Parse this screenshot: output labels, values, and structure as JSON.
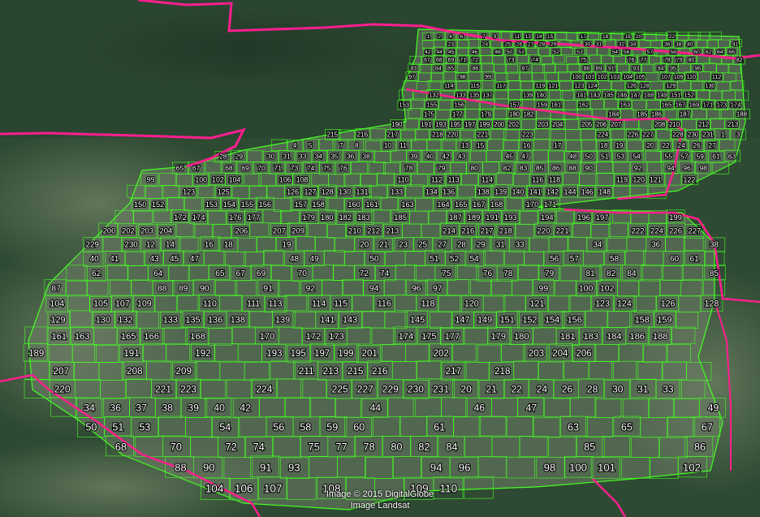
{
  "map": {
    "attribution_lines": [
      "Image © 2015 DigitalGlobe",
      "Image Landsat"
    ],
    "colors": {
      "terrain_base": "#2f4a33",
      "forest_dark": "#243d2a",
      "field_light": "#7a8f6e",
      "parcel_outline": "#44ff22",
      "boundary": "#ff1f8e",
      "label_fill": "#ffffff",
      "label_halo": "#000000"
    },
    "layers": [
      "satellite-imagery",
      "parcel-grid",
      "administrative-boundary",
      "parcel-numbers"
    ],
    "parcel_label_range": [
      1,
      231
    ]
  }
}
